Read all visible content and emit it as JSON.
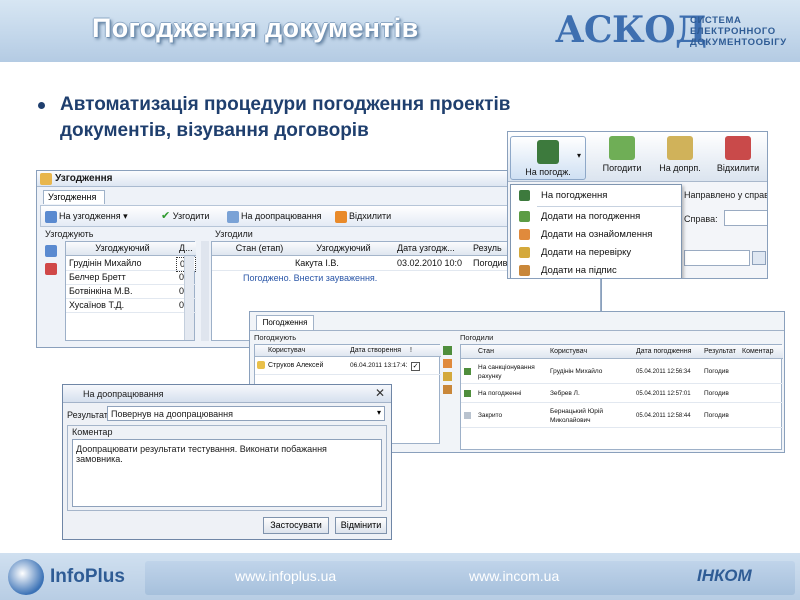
{
  "slide": {
    "title": "Погодження документів",
    "bullet": "Автоматизація процедури погодження проектів документів, візування договорів"
  },
  "logo": {
    "askod": "АСКОД",
    "line1": "СИСТЕМА",
    "line2": "ЕЛЕКТРОННОГО",
    "line3": "ДОКУМЕНТООБІГУ"
  },
  "window1": {
    "title": "Узгодження",
    "tab": "Узгодження",
    "toolbar": {
      "send": "На узгодження",
      "approve": "Узгодити",
      "rework": "На доопрацювання",
      "reject": "Відхилити"
    },
    "left_panel": {
      "title": "Узгоджують",
      "columns": [
        "Узгоджуючий",
        "Д..."
      ],
      "rows": [
        {
          "name": "Грудінін Михайло",
          "date": "03."
        },
        {
          "name": "Белчер Бретт",
          "date": "03."
        },
        {
          "name": "Ботвінкіна М.В.",
          "date": "03."
        },
        {
          "name": "Хусаїнов Т.Д.",
          "date": "03."
        }
      ]
    },
    "right_panel": {
      "title": "Узгодили",
      "columns": [
        "Стан (етап)",
        "Узгоджуючий",
        "Дата узгодж...",
        "Резуль"
      ],
      "row": {
        "stage": "",
        "person": "Какута І.В.",
        "date": "03.02.2010 10:0",
        "result": "Погодив"
      },
      "note": "Погоджено. Внести зауваження."
    }
  },
  "window2": {
    "buttons": [
      "На погодж.",
      "Погодити",
      "На допрп.",
      "Відхилити"
    ],
    "menu": [
      "На погодження",
      "Додати на погодження",
      "Додати на ознайомлення",
      "Додати на перевірку",
      "Додати на підпис"
    ],
    "side": {
      "sent": "Направлено у справу",
      "case_label": "Справа:"
    }
  },
  "window3": {
    "tab": "Погодження",
    "left": {
      "title": "Погоджують",
      "columns": [
        "Користувач",
        "Дата створення",
        "!"
      ],
      "row": {
        "user": "Струков Алексей",
        "date": "06.04.2011 13:17:41"
      }
    },
    "right": {
      "title": "Погодили",
      "columns": [
        "Стан",
        "Користувач",
        "Дата погодження",
        "Результат",
        "Коментар"
      ],
      "rows": [
        {
          "stage": "На санкціонування рахунку",
          "user": "Грудінін Михайло",
          "date": "05.04.2011 12:56:34",
          "result": "Погодив"
        },
        {
          "stage": "На погодженні",
          "user": "Зебрев Л.",
          "date": "05.04.2011 12:57:01",
          "result": "Погодив"
        },
        {
          "stage": "Закрито",
          "user": "Бернацький Юрій Миколайович",
          "date": "05.04.2011 12:58:44",
          "result": "Погодив"
        }
      ]
    }
  },
  "window4": {
    "title": "На доопрацювання",
    "result_label": "Результат",
    "result_value": "Повернув на доопрацювання",
    "comment_label": "Коментар",
    "comment_text": "Доопрацювати результати тестування. Виконати побажання замовника.",
    "apply": "Застосувати",
    "cancel": "Відмінити"
  },
  "footer": {
    "infoplus": "InfoPlus",
    "url1": "www.infoplus.ua",
    "url2": "www.incom.ua",
    "incom": "ІНКОМ"
  },
  "colors": {
    "title_text": "#ffffff",
    "bullet_text": "#1f3f6e",
    "header_bg": "#c2d6ea",
    "accent_blue": "#2f5c95"
  }
}
